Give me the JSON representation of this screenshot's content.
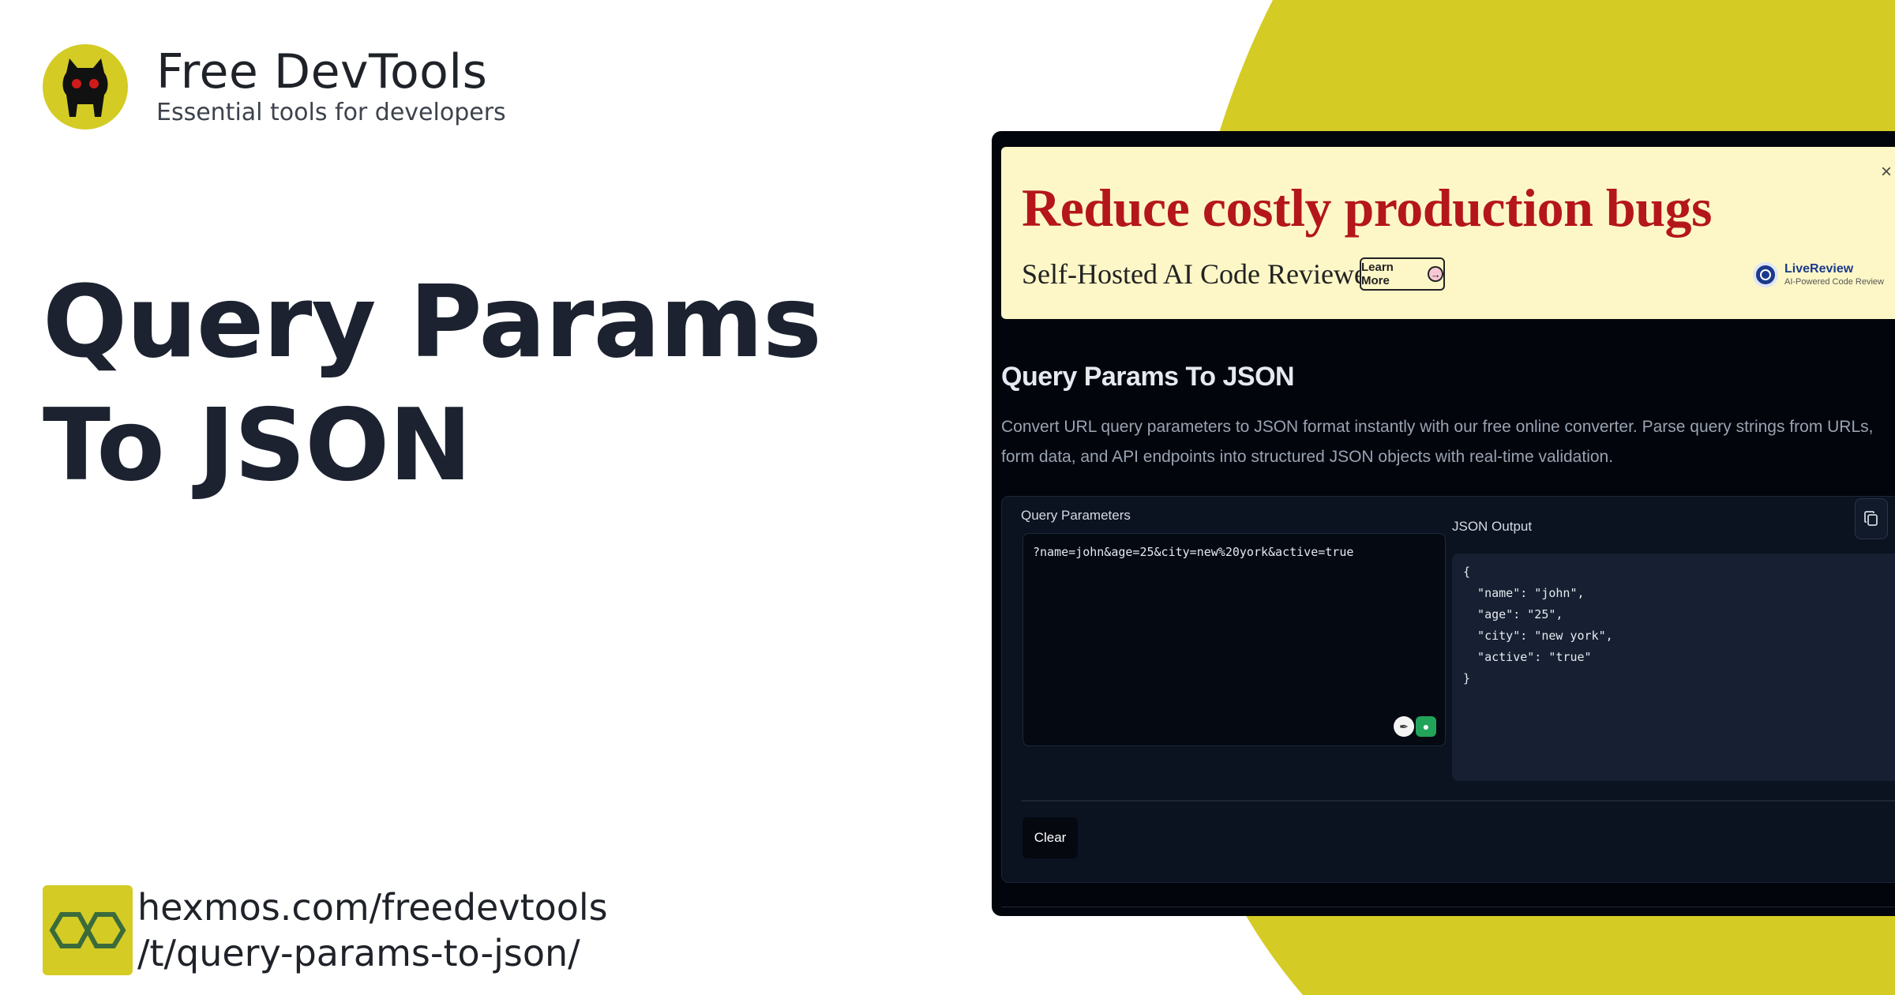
{
  "brand": {
    "name": "Free DevTools",
    "tagline": "Essential tools for developers"
  },
  "headline": {
    "line1": "Query Params",
    "line2": "To JSON"
  },
  "footer": {
    "url_line1": "hexmos.com/freedevtools",
    "url_line2": "/t/query-params-to-json/"
  },
  "colors": {
    "accent_yellow": "#d4cb25",
    "panel_bg": "#02050c",
    "ad_bg": "#fdf7c7",
    "ad_title": "#b4161b"
  },
  "ad": {
    "title": "Reduce costly production bugs",
    "subtitle": "Self-Hosted AI Code Reviewer",
    "button_label": "Learn More",
    "brand_name": "LiveReview",
    "brand_tagline": "AI-Powered Code Review",
    "close_label": "×"
  },
  "tool": {
    "title": "Query Params To JSON",
    "description": "Convert URL query parameters to JSON format instantly with our free online converter. Parse query strings from URLs, form data, and API endpoints into structured JSON objects with real-time validation.",
    "input_label": "Query Parameters",
    "input_value": "?name=john&age=25&city=new%20york&active=true",
    "output_label": "JSON Output",
    "output_value": "{\n  \"name\": \"john\",\n  \"age\": \"25\",\n  \"city\": \"new york\",\n  \"active\": \"true\"\n}",
    "clear_label": "Clear"
  },
  "icons": [
    "cat-logo-icon",
    "hexmos-logo-icon",
    "arrow-right-icon",
    "close-icon",
    "copy-icon",
    "livereview-logo-icon",
    "feather-icon",
    "grammar-extension-icon"
  ]
}
